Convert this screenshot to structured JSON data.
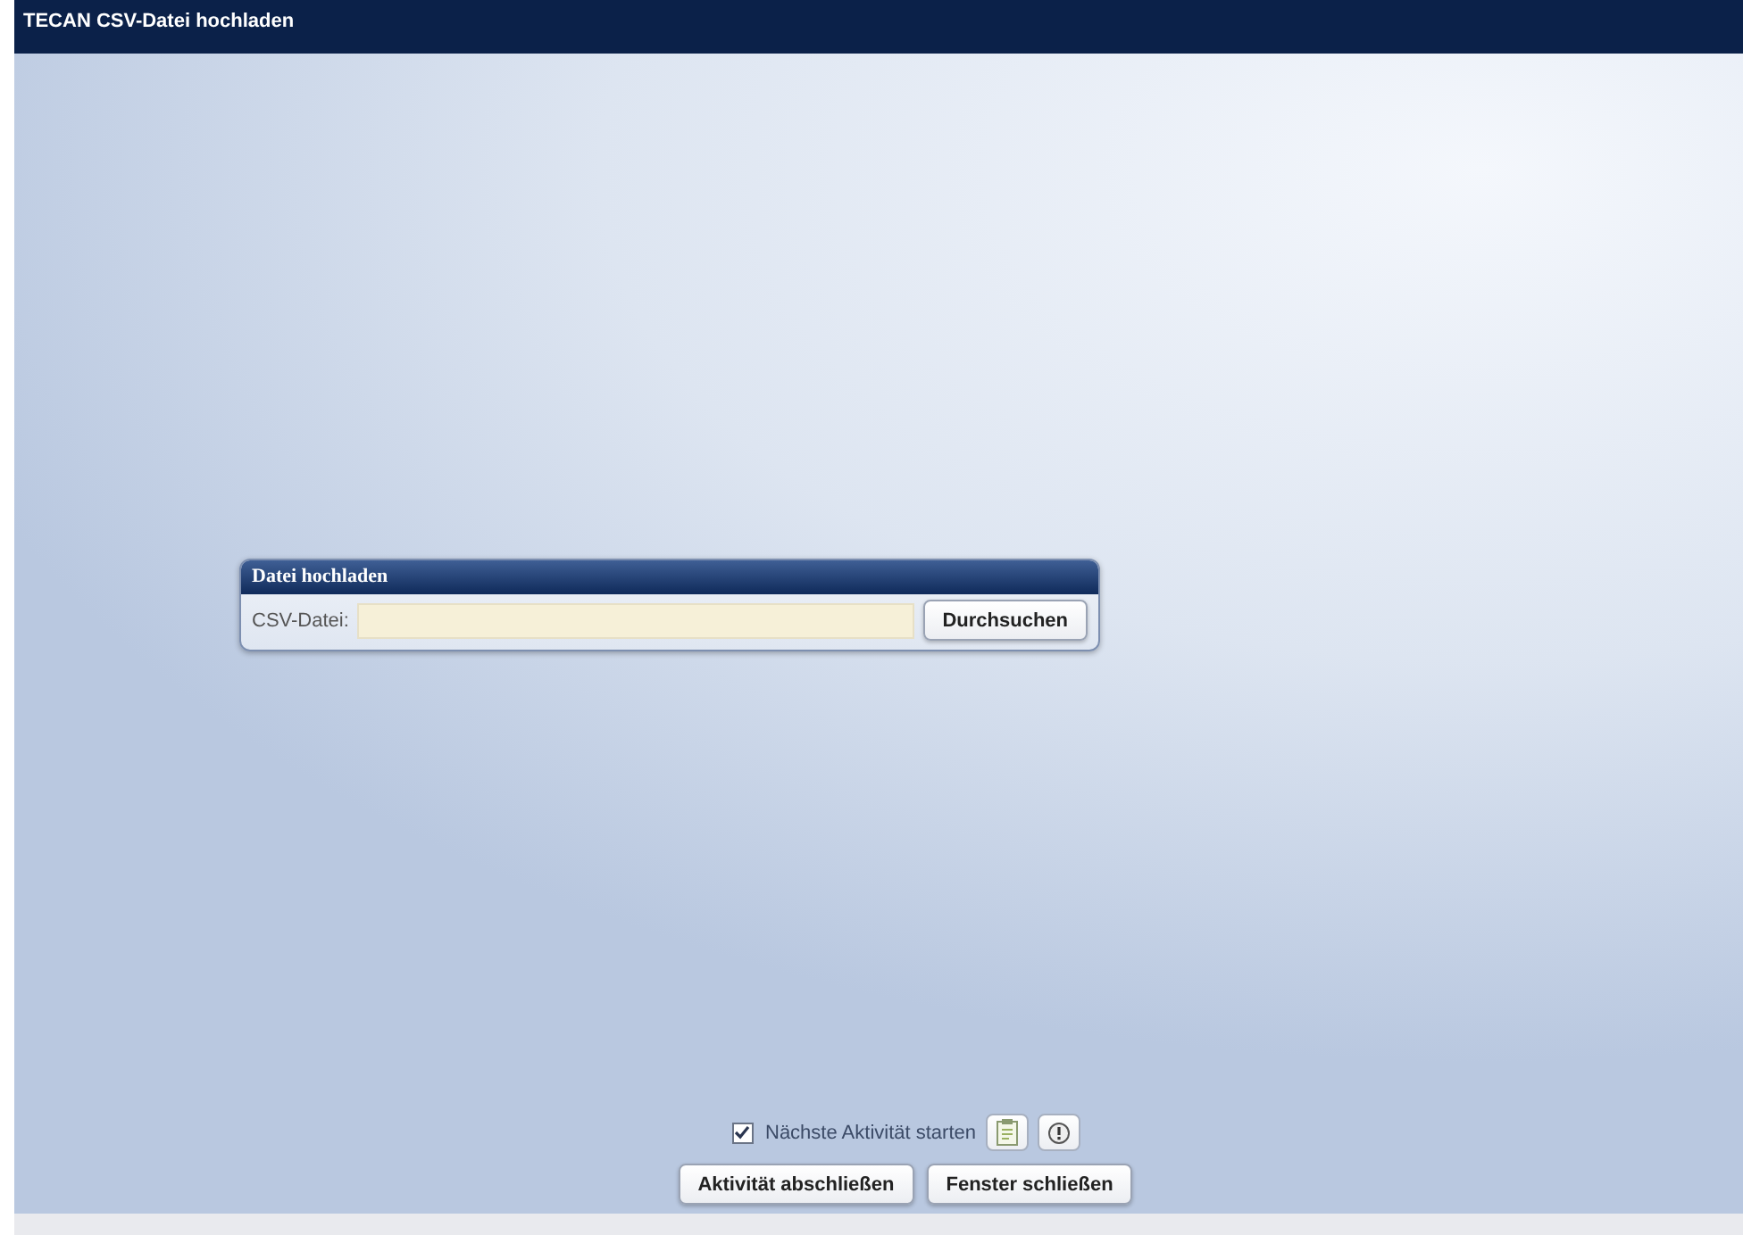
{
  "window": {
    "title": "TECAN CSV-Datei hochladen"
  },
  "upload_panel": {
    "title": "Datei hochladen",
    "field_label": "CSV-Datei:",
    "browse_button": "Durchsuchen"
  },
  "next_activity": {
    "label": "Nächste Aktivität starten",
    "checked": true
  },
  "buttons": [
    "Aktivität abschließen",
    "Fenster schließen"
  ]
}
